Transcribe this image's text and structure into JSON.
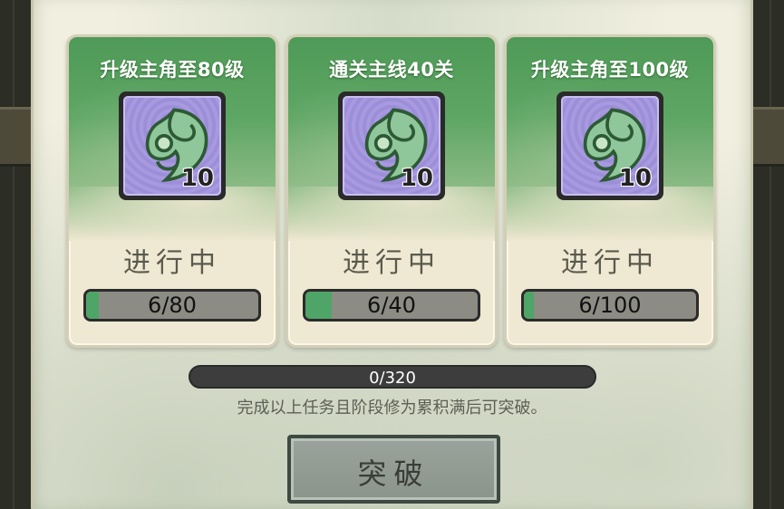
{
  "tasks": [
    {
      "title": "升级主角至80级",
      "reward_count": "10",
      "status": "进行中",
      "progress_text": "6/80",
      "progress_fraction": 0.075
    },
    {
      "title": "通关主线40关",
      "reward_count": "10",
      "status": "进行中",
      "progress_text": "6/40",
      "progress_fraction": 0.15
    },
    {
      "title": "升级主角至100级",
      "reward_count": "10",
      "status": "进行中",
      "progress_text": "6/100",
      "progress_fraction": 0.06
    }
  ],
  "total": {
    "progress_text": "0/320",
    "progress_fraction": 0
  },
  "hint": "完成以上任务且阶段修为累积满后可突破。",
  "break_button": "突破",
  "icons": {
    "reward_item": "jade-leaf-icon"
  },
  "colors": {
    "accent": "#4fa567",
    "card_top": "#4f9a58",
    "item_bg": "#a89ae0"
  }
}
